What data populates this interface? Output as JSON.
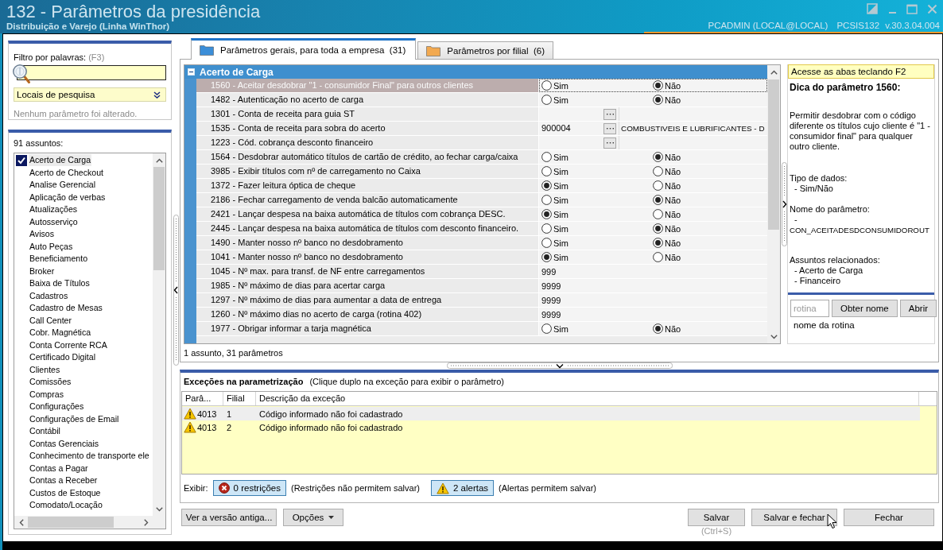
{
  "window": {
    "title": "132 - Parâmetros da presidência",
    "subtitle": "Distribuição e Varejo (Linha WinThor)",
    "user": "PCADMIN (LOCAL@LOCAL)",
    "program": "PCSIS132",
    "version": "v.30.3.04.004"
  },
  "filter": {
    "label": "Filtro por palavras:",
    "shortcut": "(F3)",
    "search_scope": "Locais de pesquisa",
    "status": "Nenhum parâmetro foi alterado."
  },
  "subjects": {
    "count": "91 assuntos:",
    "items": [
      {
        "label": "Acerto de Carga",
        "checked": true,
        "selected": true
      },
      {
        "label": "Acerto de Checkout",
        "checked": false,
        "selected": false
      },
      {
        "label": "Analise Gerencial",
        "checked": false,
        "selected": false
      },
      {
        "label": "Aplicação de verbas",
        "checked": false,
        "selected": false
      },
      {
        "label": "Atualizações",
        "checked": false,
        "selected": false
      },
      {
        "label": "Autosserviço",
        "checked": false,
        "selected": false
      },
      {
        "label": "Avisos",
        "checked": false,
        "selected": false
      },
      {
        "label": "Auto Peças",
        "checked": false,
        "selected": false
      },
      {
        "label": "Beneficiamento",
        "checked": false,
        "selected": false
      },
      {
        "label": "Broker",
        "checked": false,
        "selected": false
      },
      {
        "label": "Baixa de Títulos",
        "checked": false,
        "selected": false
      },
      {
        "label": "Cadastros",
        "checked": false,
        "selected": false
      },
      {
        "label": "Cadastro de Mesas",
        "checked": false,
        "selected": false
      },
      {
        "label": "Call Center",
        "checked": false,
        "selected": false
      },
      {
        "label": "Cobr. Magnética",
        "checked": false,
        "selected": false
      },
      {
        "label": "Conta Corrente RCA",
        "checked": false,
        "selected": false
      },
      {
        "label": "Certificado Digital",
        "checked": false,
        "selected": false
      },
      {
        "label": "Clientes",
        "checked": false,
        "selected": false
      },
      {
        "label": "Comissões",
        "checked": false,
        "selected": false
      },
      {
        "label": "Compras",
        "checked": false,
        "selected": false
      },
      {
        "label": "Configurações",
        "checked": false,
        "selected": false
      },
      {
        "label": "Configurações de Email",
        "checked": false,
        "selected": false
      },
      {
        "label": "Contábil",
        "checked": false,
        "selected": false
      },
      {
        "label": "Contas Gerenciais",
        "checked": false,
        "selected": false
      },
      {
        "label": "Conhecimento de transporte ele",
        "checked": false,
        "selected": false
      },
      {
        "label": "Contas a Pagar",
        "checked": false,
        "selected": false
      },
      {
        "label": "Contas a Receber",
        "checked": false,
        "selected": false
      },
      {
        "label": "Custos de Estoque",
        "checked": false,
        "selected": false
      },
      {
        "label": "Comodato/Locação",
        "checked": false,
        "selected": false
      }
    ]
  },
  "tabs": [
    {
      "label": "Parâmetros gerais, para toda a empresa  (31)",
      "selected": true,
      "color": "#3b8ed8"
    },
    {
      "label": "Parâmetros por filial  (6)",
      "selected": false,
      "color": "#f2a950"
    }
  ],
  "parameters": {
    "group": {
      "title": "Acerto de Carga",
      "expanded": true
    },
    "rows": [
      {
        "label": "1560 - Aceitar desdobrar \"1 - consumidor Final\" para outros clientes",
        "kind": "yes_no",
        "selected": true,
        "options": [
          {
            "label": "Sim",
            "selected": false
          },
          {
            "label": "Não",
            "selected": true
          }
        ]
      },
      {
        "label": "1482 - Autenticação no acerto de carga",
        "kind": "yes_no",
        "selected": false,
        "options": [
          {
            "label": "Sim",
            "selected": false
          },
          {
            "label": "Não",
            "selected": true
          }
        ]
      },
      {
        "label": "1301 - Conta de receita para guia ST",
        "kind": "lookup",
        "selected": false
      },
      {
        "label": "1535 - Conta de receita para sobra do acerto",
        "kind": "lookup",
        "selected": false,
        "code": "900004",
        "description": "COMBUSTIVEIS E LUBRIFICANTES - D"
      },
      {
        "label": "1223 - Cód. cobrança desconto financeiro",
        "kind": "lookup",
        "selected": false
      },
      {
        "label": "1564 - Desdobrar automático títulos de cartão de crédito, ao fechar carga/caixa",
        "kind": "yes_no",
        "selected": false,
        "options": [
          {
            "label": "Sim",
            "selected": false
          },
          {
            "label": "Não",
            "selected": true
          }
        ]
      },
      {
        "label": "3985 - Exibir títulos com nº de carregamento no Caixa",
        "kind": "yes_no",
        "selected": false,
        "options": [
          {
            "label": "Sim",
            "selected": false
          },
          {
            "label": "Não",
            "selected": false
          }
        ]
      },
      {
        "label": "1372 - Fazer leitura óptica de cheque",
        "kind": "yes_no",
        "selected": false,
        "options": [
          {
            "label": "Sim",
            "selected": true
          },
          {
            "label": "Não",
            "selected": false
          }
        ]
      },
      {
        "label": "2186 - Fechar carregamento de venda balcão automaticamente",
        "kind": "yes_no",
        "selected": false,
        "options": [
          {
            "label": "Sim",
            "selected": false
          },
          {
            "label": "Não",
            "selected": true
          }
        ]
      },
      {
        "label": "2421 - Lançar despesa na baixa automática de títulos com cobrança DESC.",
        "kind": "yes_no",
        "selected": false,
        "options": [
          {
            "label": "Sim",
            "selected": true
          },
          {
            "label": "Não",
            "selected": false
          }
        ]
      },
      {
        "label": "2445 - Lançar despesa na baixa automática de títulos com desconto financeiro.",
        "kind": "yes_no",
        "selected": false,
        "options": [
          {
            "label": "Sim",
            "selected": false
          },
          {
            "label": "Não",
            "selected": true
          }
        ]
      },
      {
        "label": "1490 - Manter nosso nº banco no desdobramento",
        "kind": "yes_no",
        "selected": false,
        "options": [
          {
            "label": "Sim",
            "selected": false
          },
          {
            "label": "Não",
            "selected": true
          }
        ]
      },
      {
        "label": "1041 - Manter nosso nº banco no desdobramento",
        "kind": "yes_no",
        "selected": false,
        "options": [
          {
            "label": "Sim",
            "selected": true
          },
          {
            "label": "Não",
            "selected": false
          }
        ]
      },
      {
        "label": "1045 - Nº max. para transf. de NF entre carregamentos",
        "kind": "number",
        "selected": false,
        "value": "999"
      },
      {
        "label": "1985 - Nº máximo de dias para acertar carga",
        "kind": "number",
        "selected": false,
        "value": "9999"
      },
      {
        "label": "1297 - Nº máximo de dias para aumentar a data de entrega",
        "kind": "number",
        "selected": false,
        "value": "9999"
      },
      {
        "label": "1260 - Nº máximo dias no acerto de carga (rotina 402)",
        "kind": "number",
        "selected": false,
        "value": "9999"
      },
      {
        "label": "1977 - Obrigar informar a tarja magnética",
        "kind": "yes_no",
        "selected": false,
        "options": [
          {
            "label": "Sim",
            "selected": false
          },
          {
            "label": "Não",
            "selected": true
          }
        ]
      }
    ],
    "summary": "1 assunto, 31 parâmetros"
  },
  "hint": {
    "shortcut_tip": "Acesse as abas teclando F2",
    "title": "Dica do parâmetro 1560:",
    "description": "Permitir desdobrar com o código diferente os títulos cujo cliente é \"1 - consumidor final\" para qualquer outro cliente.",
    "data_type_label": "Tipo de dados:",
    "data_type": "- Sim/Não",
    "name_label": "Nome do parâmetro:",
    "name_prefix": "-",
    "name": "CON_ACEITADESDCONSUMIDOROUT",
    "related_label": "Assuntos relacionados:",
    "related": [
      "- Acerto de Carga",
      "- Financeiro"
    ]
  },
  "routine_lookup": {
    "placeholder": "rotina",
    "buttons": [
      "Obter nome",
      "Abrir"
    ],
    "result": "nome da rotina"
  },
  "exceptions": {
    "title": "Exceções na parametrização",
    "hint": "(Clique duplo na exceção para exibir o parâmetro)",
    "columns": [
      "Parâ...",
      "Filial",
      "Descrição da exceção"
    ],
    "rows": [
      {
        "kind": "warning",
        "parameter": "4013",
        "branch": "1",
        "description": "Código informado não foi cadastrado",
        "selected": true
      },
      {
        "kind": "warning",
        "parameter": "4013",
        "branch": "2",
        "description": "Código informado não foi cadastrado",
        "selected": false
      }
    ],
    "show_label": "Exibir:",
    "filters": [
      {
        "kind": "error",
        "label": "0 restrições",
        "note": "(Restrições não permitem salvar)",
        "on": true
      },
      {
        "kind": "warning",
        "label": "2 alertas",
        "note": "(Alertas permitem salvar)",
        "on": true
      }
    ]
  },
  "footer": {
    "left_buttons": [
      {
        "label": "Ver a versão antiga...",
        "kind": "plain"
      },
      {
        "label": "Opções",
        "kind": "menu"
      }
    ],
    "right_buttons": [
      {
        "label": "Salvar",
        "shortcut": "(Ctrl+S)"
      },
      {
        "label": "Salvar e fechar"
      },
      {
        "label": "Fechar"
      }
    ]
  }
}
